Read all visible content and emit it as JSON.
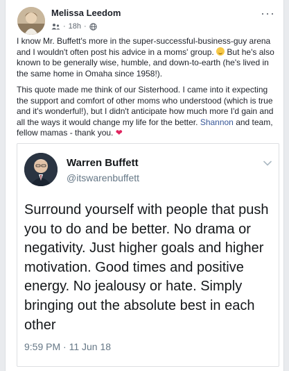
{
  "post": {
    "author": "Melissa Leedom",
    "time": "18h",
    "dot": "·",
    "more_label": "···",
    "paragraph1_before_emoji": "I know Mr. Buffett's more in the super-successful-business-guy arena and I wouldn't often post his advice in a moms' group. ",
    "paragraph1_after_emoji": " But he's also known to be generally wise, humble, and down-to-earth (he's lived in the same home in Omaha since 1958!).",
    "paragraph2_before_link": "This quote made me think of our Sisterhood. I came into it expecting the support and comfort of other moms who understood (which is true and it's wonderful!), but I didn't anticipate how much more I'd gain and all the ways it would change my life for the better. ",
    "mention": "Shannon",
    "paragraph2_after_link": " and team, fellow mamas - thank you. ",
    "heart_glyph": "❤"
  },
  "tweet": {
    "name": "Warren Buffett",
    "handle": "@itswarenbuffett",
    "text": "Surround yourself with people that push you to do and be better. No drama or negativity. Just higher goals and higher motivation. Good times and positive energy. No jealousy or hate. Simply bringing out the absolute best in each other",
    "timestamp": "9:59 PM · 11 Jun 18"
  },
  "icons": {
    "more": "more-options-icon",
    "audience": "globe-icon",
    "group": "group-icon",
    "chevron": "chevron-down-icon",
    "emoji": "smiling-emoji-icon",
    "heart": "heart-icon"
  },
  "colors": {
    "link": "#385898",
    "heart": "#e0245e",
    "emoji": "#f7c948"
  }
}
